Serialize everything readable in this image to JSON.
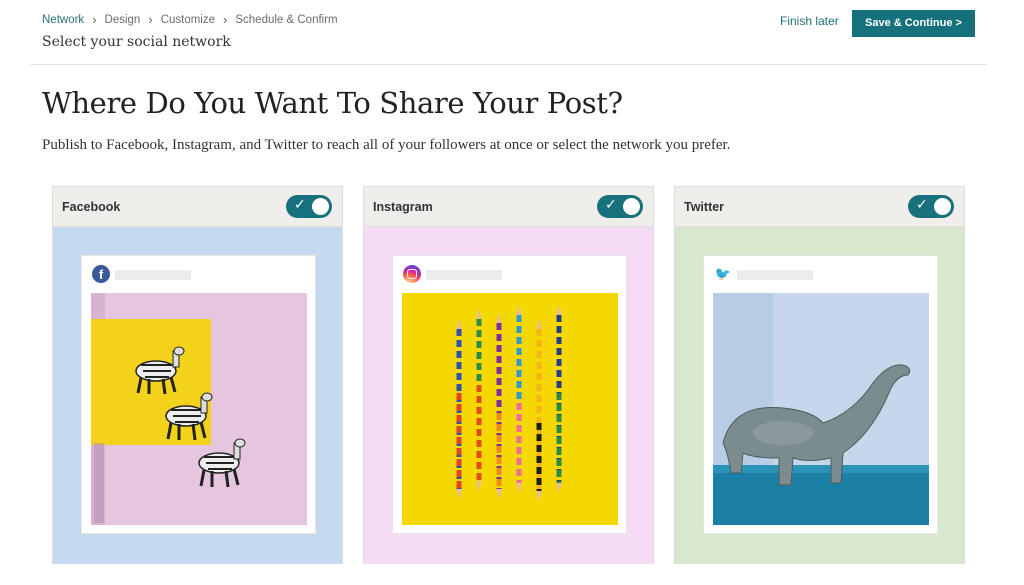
{
  "breadcrumb": {
    "items": [
      "Network",
      "Design",
      "Customize",
      "Schedule & Confirm"
    ]
  },
  "header": {
    "subtitle": "Select your social network",
    "finish_later": "Finish later",
    "save_continue": "Save & Continue >"
  },
  "main": {
    "title": "Where Do You Want To Share Your Post?",
    "description": "Publish to Facebook, Instagram, and Twitter to reach all of your followers at once or select the network you prefer."
  },
  "cards": [
    {
      "name": "Facebook",
      "enabled": true,
      "icon": "facebook-icon",
      "body_color": "#c5d9ef",
      "image": "zebra-figurines"
    },
    {
      "name": "Instagram",
      "enabled": true,
      "icon": "instagram-icon",
      "body_color": "#f5dcf4",
      "image": "colored-pencils"
    },
    {
      "name": "Twitter",
      "enabled": true,
      "icon": "twitter-icon",
      "body_color": "#d7e8cf",
      "image": "toy-dinosaur"
    }
  ],
  "colors": {
    "accent": "#17717c",
    "header_bg": "#efeeeb"
  }
}
